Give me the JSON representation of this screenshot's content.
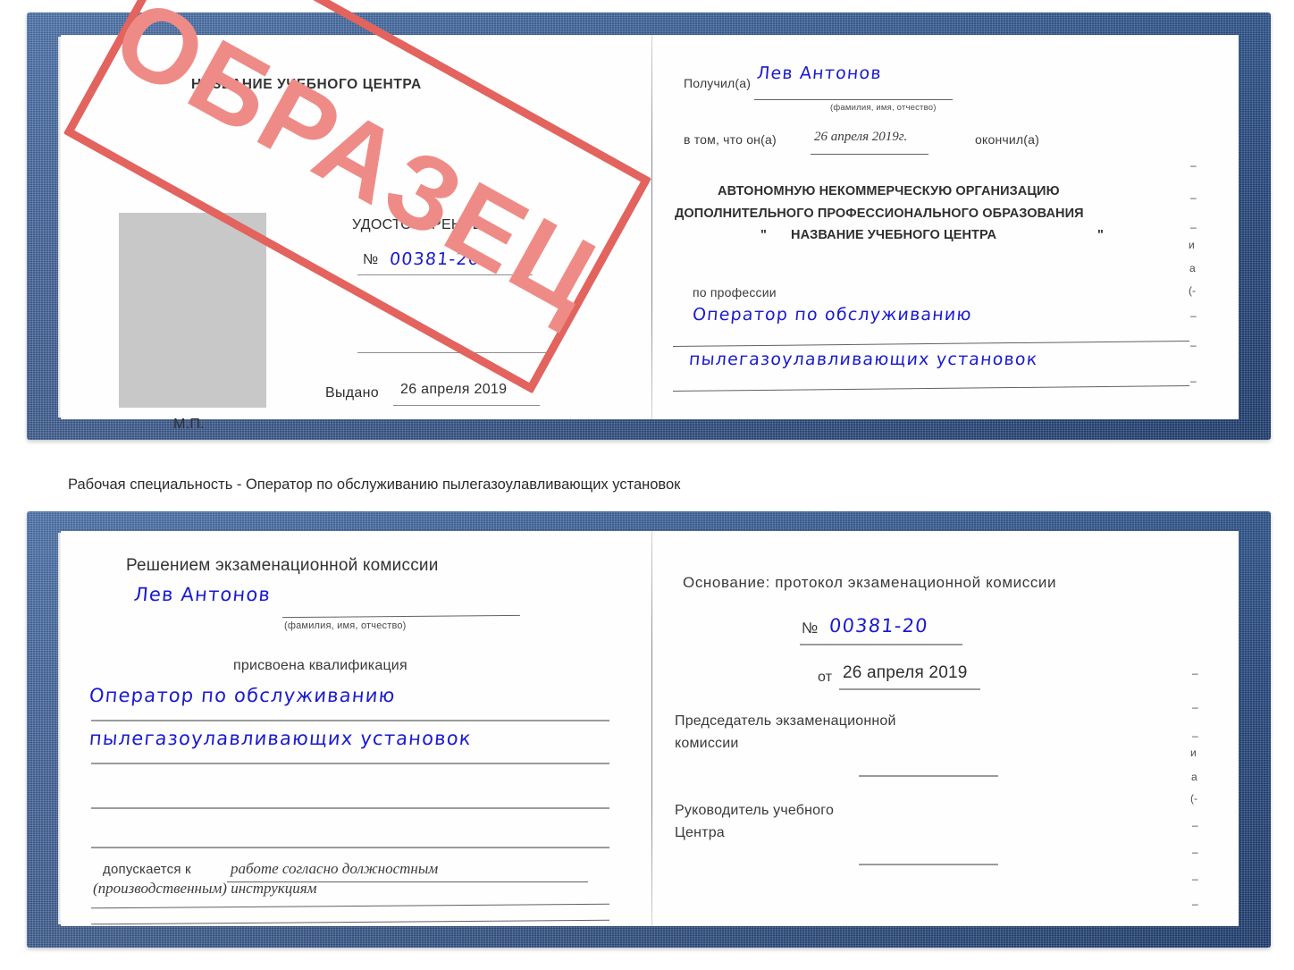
{
  "colors": {
    "cover_blue": "#1f4480",
    "stamp_red": "#e3635e",
    "stamp_word": "#ef8b86",
    "ink_blue": "#1a1ad2",
    "rule_gray": "#8e8e8e",
    "photo_gray": "#c8c8c8"
  },
  "caption": {
    "text": "Рабочая специальность - Оператор по обслуживанию пылегазоулавливающих установок"
  },
  "stamp": {
    "text": "ОБРАЗЕЦ"
  },
  "certificate_1": {
    "left_page": {
      "center_name": "НАЗВАНИЕ УЧЕБНОГО ЦЕНТРА",
      "doc_title": "УДОСТОВЕРЕНИЕ",
      "number_label": "№",
      "number_value": "00381-20",
      "issued_label": "Выдано",
      "issued_value": "26 апреля 2019",
      "seal_label": "М.П.",
      "photo_placeholder": "photo-area"
    },
    "right_page": {
      "received_label": "Получил(а)",
      "received_value": "Лев Антонов",
      "received_hint": "(фамилия, имя, отчество)",
      "that_label": "в том, что он(а)",
      "that_date": "26 апреля 2019г.",
      "finished_label": "окончил(а)",
      "org_line1": "АВТОНОМНУЮ НЕКОММЕРЧЕСКУЮ ОРГАНИЗАЦИЮ",
      "org_line2": "ДОПОЛНИТЕЛЬНОГО ПРОФЕССИОНАЛЬНОГО ОБРАЗОВАНИЯ",
      "org_quote_open": "\"",
      "org_line3": "НАЗВАНИЕ УЧЕБНОГО ЦЕНТРА",
      "org_quote_close": "\"",
      "profession_label": "по профессии",
      "profession_value_line1": "Оператор по обслуживанию",
      "profession_value_line2": "пылегазоулавливающих установок",
      "edge_fragments": [
        "–",
        "–",
        "–",
        "и",
        "а",
        "(-",
        "–",
        "–",
        "–"
      ]
    }
  },
  "certificate_2": {
    "left_page": {
      "heading": "Решением экзаменационной комиссии",
      "name_value": "Лев Антонов",
      "name_hint": "(фамилия, имя, отчество)",
      "qualification_label": "присвоена квалификация",
      "qualification_line1": "Оператор по обслуживанию",
      "qualification_line2": "пылегазоулавливающих установок",
      "admitted_label": "допускается к",
      "admitted_value_line1": "работе согласно должностным",
      "admitted_value_line2": "(производственным) инструкциям"
    },
    "right_page": {
      "basis_label": "Основание: протокол экзаменационной комиссии",
      "number_label": "№",
      "number_value": "00381-20",
      "date_label": "от",
      "date_value": "26 апреля 2019",
      "chairman_line1": "Председатель экзаменационной",
      "chairman_line2": "комиссии",
      "head_line1": "Руководитель учебного",
      "head_line2": "Центра",
      "edge_fragments": [
        "–",
        "–",
        "–",
        "и",
        "а",
        "(-",
        "–",
        "–",
        "–",
        "–"
      ]
    }
  }
}
